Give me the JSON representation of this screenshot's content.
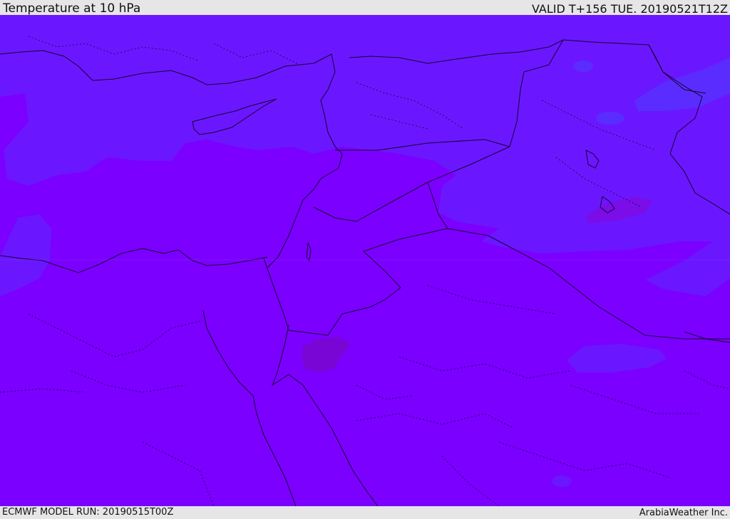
{
  "header": {
    "title": "Temperature at 10 hPa",
    "valid": "VALID T+156 TUE. 20190521T12Z"
  },
  "footer": {
    "model_run": "ECMWF MODEL RUN: 20190515T00Z",
    "credit": "ArabiaWeather Inc."
  },
  "map": {
    "region": "Eastern Mediterranean / Middle East",
    "colors": {
      "base_field": "#7b00ff",
      "cooler_field": "#6a17ff",
      "warm_spot": "#7a06d6",
      "border": "#1a0033",
      "chrome": "#e6e6e6"
    }
  }
}
